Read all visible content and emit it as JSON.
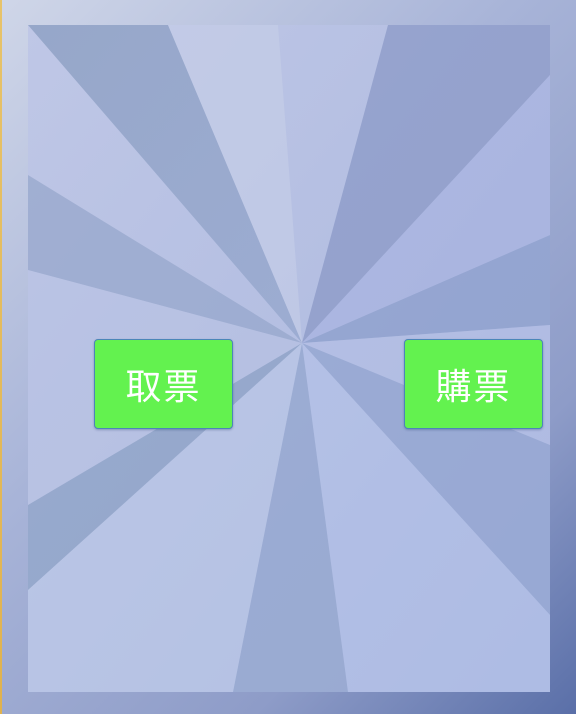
{
  "buttons": {
    "retrieve_ticket_label": "取票",
    "buy_ticket_label": "購票"
  },
  "colors": {
    "button_fill": "#63f24f",
    "button_text": "#ffffff",
    "background_light": "#c2cbe6",
    "background_dark": "#8ea0c6"
  }
}
